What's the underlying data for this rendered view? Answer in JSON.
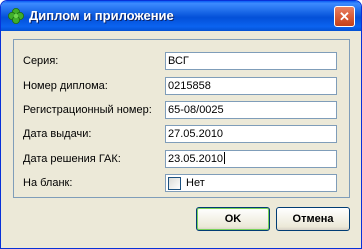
{
  "window": {
    "title": "Диплом и приложение",
    "close_label": "✕"
  },
  "form": {
    "fields": [
      {
        "label": "Серия:",
        "value": "ВСГ"
      },
      {
        "label": "Номер диплома:",
        "value": "0215858"
      },
      {
        "label": "Регистрационный номер:",
        "value": "65-08/0025"
      },
      {
        "label": "Дата выдачи:",
        "value": "27.05.2010"
      },
      {
        "label": "Дата решения ГАК:",
        "value": "23.05.2010"
      }
    ],
    "blank": {
      "label": "На бланк:",
      "checkbox_label": "Нет",
      "checked": false
    }
  },
  "buttons": {
    "ok": "OK",
    "cancel": "Отмена"
  },
  "colors": {
    "title_bar": "#0350d8",
    "close_button": "#d85a35",
    "window_bg": "#ece9d8",
    "field_border": "#7f9db9"
  },
  "icons": {
    "title": "green-clover-icon",
    "close": "close-icon"
  }
}
